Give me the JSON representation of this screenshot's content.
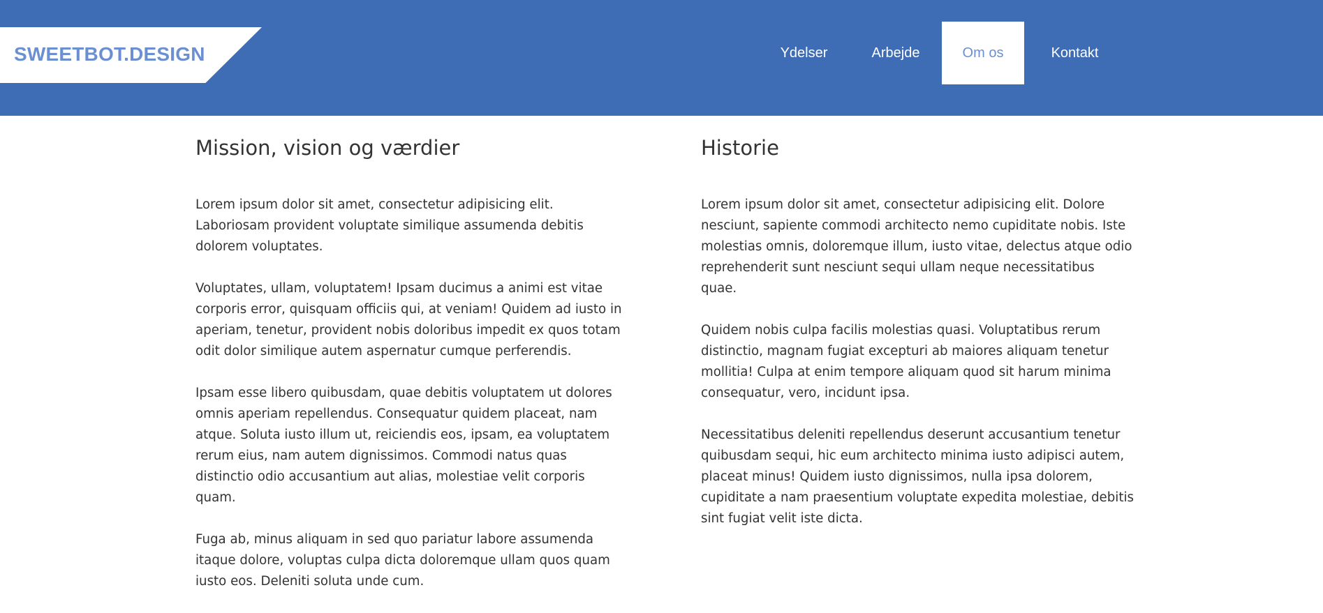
{
  "header": {
    "brand": "SWEETBOT.DESIGN",
    "accent_color": "#3e6db5",
    "nav": [
      {
        "label": "Ydelser",
        "active": false
      },
      {
        "label": "Arbejde",
        "active": false
      },
      {
        "label": "Om os",
        "active": true
      },
      {
        "label": "Kontakt",
        "active": false
      }
    ]
  },
  "left_column": {
    "title": "Mission, vision og værdier",
    "paragraphs": [
      "Lorem ipsum dolor sit amet, consectetur adipisicing elit. Laboriosam provident voluptate similique assumenda debitis dolorem voluptates.",
      "Voluptates, ullam, voluptatem! Ipsam ducimus a animi est vitae corporis error, quisquam officiis qui, at veniam! Quidem ad iusto in aperiam, tenetur, provident nobis doloribus impedit ex quos totam odit dolor similique autem aspernatur cumque perferendis.",
      "Ipsam esse libero quibusdam, quae debitis voluptatem ut dolores omnis aperiam repellendus. Consequatur quidem placeat, nam atque. Soluta iusto illum ut, reiciendis eos, ipsam, ea voluptatem rerum eius, nam autem dignissimos. Commodi natus quas distinctio odio accusantium aut alias, molestiae velit corporis quam.",
      "Fuga ab, minus aliquam in sed quo pariatur labore assumenda itaque dolore, voluptas culpa dicta doloremque ullam quos quam iusto eos. Deleniti soluta unde cum."
    ]
  },
  "right_column": {
    "title": "Historie",
    "paragraphs": [
      "Lorem ipsum dolor sit amet, consectetur adipisicing elit. Dolore nesciunt, sapiente commodi architecto nemo cupiditate nobis. Iste molestias omnis, doloremque illum, iusto vitae, delectus atque odio reprehenderit sunt nesciunt sequi ullam neque necessitatibus quae.",
      "Quidem nobis culpa facilis molestias quasi. Voluptatibus rerum distinctio, magnam fugiat excepturi ab maiores aliquam tenetur mollitia! Culpa at enim tempore aliquam quod sit harum minima consequatur, vero, incidunt ipsa.",
      "Necessitatibus deleniti repellendus deserunt accusantium tenetur quibusdam sequi, hic eum architecto minima iusto adipisci autem, placeat minus! Quidem iusto dignissimos, nulla ipsa dolorem, cupiditate a nam praesentium voluptate expedita molestiae, debitis sint fugiat velit iste dicta."
    ]
  }
}
